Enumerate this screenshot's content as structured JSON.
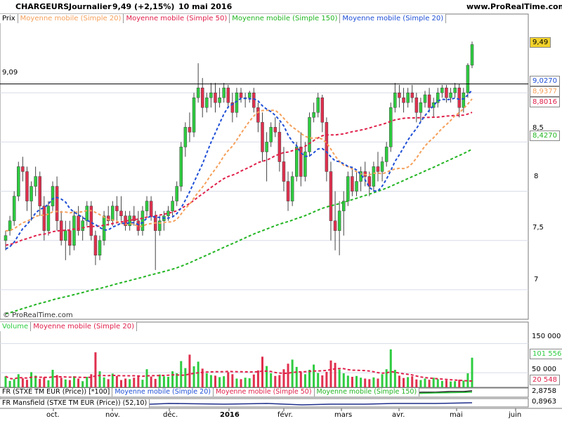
{
  "header": {
    "symbol": "CHARGEURS",
    "period": "Journalier",
    "price_change": "9,49 (+2,15%)",
    "date": "10 mai 2016",
    "site": "www.ProRealTime.com"
  },
  "legend": {
    "price": "Prix",
    "ma20_orange": "Moyenne mobile (Simple 20)",
    "ma50": "Moyenne mobile (Simple 50)",
    "ma150": "Moyenne mobile (Simple 150)",
    "ma20_blue": "Moyenne mobile (Simple 20)"
  },
  "watermark": "© ProRealTime.com",
  "resistance_label": "9,09",
  "price_axis_labels": [
    "8,5",
    "8",
    "7,5",
    "7"
  ],
  "price_tags": {
    "last": "9,49",
    "ma20_blue": "9,0270",
    "ma20_orange": "8,9377",
    "ma50": "8,8016",
    "ma150": "8,4270"
  },
  "volume_panel": {
    "legend_volume": "Volume",
    "legend_ma": "Moyenne mobile (Simple 20)",
    "axis_labels": [
      "150 000",
      "50 000"
    ],
    "tag_volume": "101 556",
    "tag_ma": "20 548"
  },
  "rs_panel_1": {
    "legend_name": "FR (STXE TM EUR (Price)) [*100]",
    "legend_ma20": "Moyenne mobile (Simple 20)",
    "legend_ma50": "Moyenne mobile (Simple 50)",
    "legend_ma150": "Moyenne mobile (Simple 150)",
    "tag": "2,8758"
  },
  "rs_panel_2": {
    "legend_name": "FR Mansfield (STXE TM EUR (Price)) (52,10)",
    "tag": "0,8963"
  },
  "x_axis_labels": [
    "oct.",
    "nov.",
    "déc.",
    "2016",
    "févr.",
    "mars",
    "avr.",
    "mai",
    "juin"
  ],
  "colors": {
    "up": "#2ecc40",
    "down": "#e0304e",
    "ma20_blue": "#1f4fd6",
    "ma20_orange": "#f5a05a",
    "ma50": "#e0204a",
    "ma150": "#22b522",
    "last_tag_bg": "#f2d22a"
  },
  "chart_data": {
    "type": "candlestick",
    "title": "CHARGEURS Journalier",
    "ylim": [
      6.7,
      9.7
    ],
    "resistance": 9.09,
    "last_close": 9.49,
    "x_months": [
      "oct.",
      "nov.",
      "déc.",
      "2016",
      "févr.",
      "mars",
      "avr.",
      "mai",
      "juin"
    ],
    "ohlc": [
      [
        7.5,
        7.6,
        7.4,
        7.55
      ],
      [
        7.6,
        7.75,
        7.55,
        7.7
      ],
      [
        7.7,
        8.0,
        7.65,
        7.95
      ],
      [
        7.95,
        8.3,
        7.9,
        8.25
      ],
      [
        8.25,
        8.35,
        8.1,
        8.2
      ],
      [
        8.2,
        8.25,
        7.8,
        7.9
      ],
      [
        7.9,
        8.1,
        7.7,
        8.05
      ],
      [
        8.05,
        8.25,
        7.95,
        8.15
      ],
      [
        8.15,
        8.2,
        7.75,
        7.85
      ],
      [
        7.85,
        7.95,
        7.5,
        7.6
      ],
      [
        7.6,
        7.9,
        7.55,
        7.85
      ],
      [
        7.85,
        8.1,
        7.8,
        8.05
      ],
      [
        8.05,
        8.15,
        7.6,
        7.7
      ],
      [
        7.7,
        7.8,
        7.45,
        7.5
      ],
      [
        7.5,
        7.7,
        7.3,
        7.6
      ],
      [
        7.6,
        7.7,
        7.35,
        7.45
      ],
      [
        7.45,
        7.8,
        7.4,
        7.75
      ],
      [
        7.75,
        7.85,
        7.55,
        7.6
      ],
      [
        7.6,
        7.75,
        7.5,
        7.7
      ],
      [
        7.7,
        7.9,
        7.65,
        7.85
      ],
      [
        7.85,
        7.9,
        7.5,
        7.55
      ],
      [
        7.55,
        7.6,
        7.25,
        7.35
      ],
      [
        7.35,
        7.55,
        7.3,
        7.5
      ],
      [
        7.5,
        7.8,
        7.45,
        7.75
      ],
      [
        7.75,
        7.85,
        7.65,
        7.7
      ],
      [
        7.7,
        7.9,
        7.65,
        7.85
      ],
      [
        7.85,
        7.95,
        7.7,
        7.8
      ],
      [
        7.8,
        7.95,
        7.7,
        7.75
      ],
      [
        7.75,
        7.8,
        7.6,
        7.65
      ],
      [
        7.65,
        7.8,
        7.6,
        7.75
      ],
      [
        7.75,
        7.85,
        7.65,
        7.7
      ],
      [
        7.7,
        7.8,
        7.55,
        7.6
      ],
      [
        7.6,
        7.85,
        7.55,
        7.8
      ],
      [
        7.8,
        7.95,
        7.75,
        7.9
      ],
      [
        7.9,
        7.95,
        7.7,
        7.75
      ],
      [
        7.75,
        7.8,
        7.2,
        7.6
      ],
      [
        7.6,
        7.75,
        7.55,
        7.7
      ],
      [
        7.7,
        7.8,
        7.6,
        7.75
      ],
      [
        7.75,
        7.85,
        7.7,
        7.8
      ],
      [
        7.8,
        7.95,
        7.75,
        7.9
      ],
      [
        7.9,
        8.1,
        7.85,
        8.05
      ],
      [
        8.05,
        8.5,
        8.0,
        8.45
      ],
      [
        8.45,
        8.7,
        8.35,
        8.65
      ],
      [
        8.65,
        8.8,
        8.5,
        8.6
      ],
      [
        8.6,
        9.0,
        8.55,
        8.95
      ],
      [
        8.95,
        9.3,
        8.9,
        9.05
      ],
      [
        9.05,
        9.15,
        8.75,
        8.85
      ],
      [
        8.85,
        9.0,
        8.8,
        8.95
      ],
      [
        8.95,
        9.1,
        8.85,
        9.0
      ],
      [
        9.0,
        9.1,
        8.8,
        8.9
      ],
      [
        8.9,
        9.05,
        8.85,
        8.95
      ],
      [
        8.95,
        9.1,
        8.9,
        9.05
      ],
      [
        9.05,
        9.08,
        8.85,
        8.9
      ],
      [
        8.9,
        9.0,
        8.7,
        8.8
      ],
      [
        8.8,
        9.05,
        8.75,
        9.0
      ],
      [
        9.0,
        9.05,
        8.9,
        8.95
      ],
      [
        8.95,
        9.0,
        8.85,
        8.95
      ],
      [
        8.95,
        9.02,
        8.9,
        9.0
      ],
      [
        9.0,
        9.05,
        8.8,
        8.85
      ],
      [
        8.85,
        8.9,
        8.6,
        8.7
      ],
      [
        8.7,
        8.8,
        8.3,
        8.4
      ],
      [
        8.4,
        8.6,
        8.1,
        8.5
      ],
      [
        8.5,
        8.7,
        8.45,
        8.65
      ],
      [
        8.65,
        8.75,
        8.55,
        8.6
      ],
      [
        8.6,
        8.7,
        8.2,
        8.3
      ],
      [
        8.3,
        8.45,
        8.0,
        8.1
      ],
      [
        8.1,
        8.2,
        7.8,
        7.9
      ],
      [
        7.9,
        8.2,
        7.85,
        8.15
      ],
      [
        8.15,
        8.5,
        8.1,
        8.45
      ],
      [
        8.45,
        8.6,
        8.05,
        8.15
      ],
      [
        8.15,
        8.5,
        8.1,
        8.4
      ],
      [
        8.4,
        8.8,
        8.35,
        8.75
      ],
      [
        8.75,
        8.9,
        8.7,
        8.8
      ],
      [
        8.8,
        9.0,
        8.75,
        8.95
      ],
      [
        8.95,
        8.98,
        8.6,
        8.7
      ],
      [
        8.7,
        8.75,
        8.1,
        8.2
      ],
      [
        8.2,
        8.3,
        7.5,
        7.7
      ],
      [
        7.7,
        8.0,
        7.4,
        7.6
      ],
      [
        7.6,
        7.9,
        7.35,
        7.8
      ],
      [
        7.8,
        8.0,
        7.55,
        7.9
      ],
      [
        7.9,
        8.2,
        7.85,
        8.15
      ],
      [
        8.15,
        8.25,
        7.95,
        8.0
      ],
      [
        8.0,
        8.2,
        7.95,
        8.1
      ],
      [
        8.1,
        8.25,
        8.0,
        8.2
      ],
      [
        8.2,
        8.3,
        8.05,
        8.15
      ],
      [
        8.15,
        8.2,
        7.95,
        8.05
      ],
      [
        8.05,
        8.3,
        8.0,
        8.25
      ],
      [
        8.25,
        8.4,
        8.1,
        8.2
      ],
      [
        8.2,
        8.35,
        8.1,
        8.3
      ],
      [
        8.3,
        8.5,
        8.25,
        8.45
      ],
      [
        8.45,
        8.9,
        8.4,
        8.85
      ],
      [
        8.85,
        9.1,
        8.8,
        9.0
      ],
      [
        9.0,
        9.08,
        8.85,
        8.95
      ],
      [
        8.95,
        9.05,
        8.8,
        8.9
      ],
      [
        8.9,
        9.05,
        8.85,
        9.0
      ],
      [
        9.0,
        9.08,
        8.9,
        8.95
      ],
      [
        8.95,
        9.0,
        8.7,
        8.8
      ],
      [
        8.8,
        8.95,
        8.7,
        8.9
      ],
      [
        8.9,
        9.02,
        8.85,
        8.98
      ],
      [
        8.98,
        9.05,
        8.8,
        8.85
      ],
      [
        8.85,
        8.95,
        8.75,
        8.9
      ],
      [
        8.9,
        9.05,
        8.85,
        9.0
      ],
      [
        9.0,
        9.08,
        8.95,
        9.05
      ],
      [
        9.05,
        9.08,
        8.9,
        8.95
      ],
      [
        8.95,
        9.05,
        8.9,
        9.0
      ],
      [
        9.0,
        9.1,
        8.95,
        9.05
      ],
      [
        9.05,
        9.09,
        8.75,
        8.85
      ],
      [
        8.85,
        9.05,
        8.8,
        9.0
      ],
      [
        9.0,
        9.3,
        8.95,
        9.28
      ],
      [
        9.28,
        9.52,
        9.25,
        9.49
      ]
    ],
    "volume": [
      38000,
      22000,
      28000,
      45000,
      31000,
      26000,
      52000,
      40000,
      29000,
      35000,
      24000,
      60000,
      42000,
      33000,
      27000,
      25000,
      38000,
      30000,
      21000,
      36000,
      45000,
      120000,
      55000,
      34000,
      28000,
      47000,
      39000,
      25000,
      30000,
      28000,
      33000,
      41000,
      26000,
      62000,
      37000,
      29000,
      44000,
      38000,
      36000,
      55000,
      48000,
      90000,
      66000,
      112000,
      72000,
      88000,
      64000,
      48000,
      42000,
      40000,
      35000,
      38000,
      52000,
      45000,
      30000,
      28000,
      33000,
      31000,
      44000,
      58000,
      105000,
      73000,
      48000,
      39000,
      42000,
      62000,
      81000,
      95000,
      70000,
      52000,
      45000,
      60000,
      78000,
      49000,
      41000,
      53000,
      92000,
      84000,
      61000,
      48000,
      40000,
      36000,
      39000,
      33000,
      30000,
      28000,
      34000,
      30000,
      45000,
      62000,
      130000,
      60000,
      40000,
      32000,
      35000,
      38000,
      27000,
      25000,
      30000,
      26000,
      33000,
      28000,
      22000,
      24000,
      20000,
      21000,
      26000,
      23000,
      48000,
      101556
    ],
    "ma20_blue_last": 9.027,
    "ma20_orange_last": 8.9377,
    "ma50_last": 8.8016,
    "ma150_last": 8.427,
    "volume_ma20_last": 20548
  }
}
